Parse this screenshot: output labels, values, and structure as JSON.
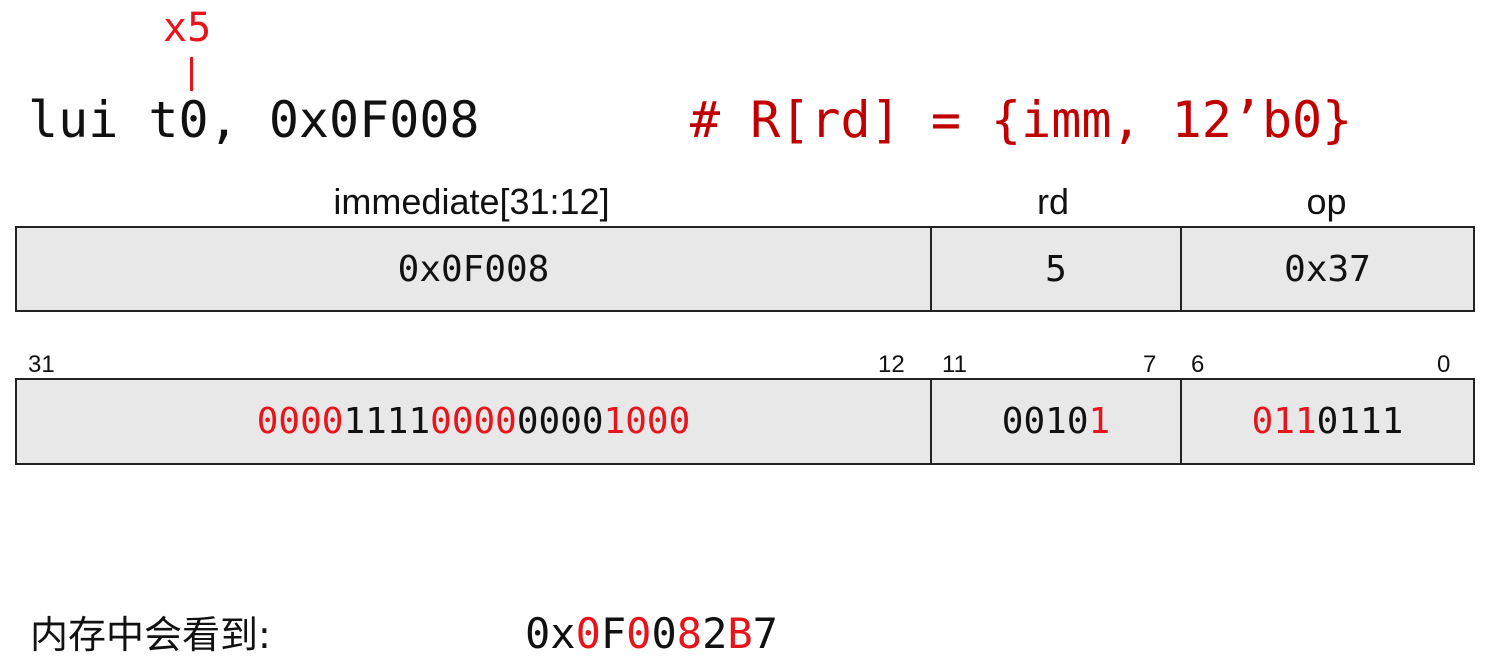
{
  "register": {
    "name": "x5"
  },
  "instruction": {
    "text": "lui t0, 0x0F008",
    "comment": "# R[rd] = {imm, 12’b0}"
  },
  "fields": {
    "headers": {
      "immediate": "immediate[31:12]",
      "rd": "rd",
      "op": "op"
    },
    "values": {
      "immediate": "0x0F008",
      "rd": "5",
      "op": "0x37"
    }
  },
  "bit_numbers": {
    "imm_hi": "31",
    "imm_lo": "12",
    "rd_hi": "11",
    "rd_lo": "7",
    "op_hi": "6",
    "op_lo": "0"
  },
  "binary": {
    "immediate_groups": [
      {
        "bits": "0000",
        "highlight": true
      },
      {
        "bits": "1111",
        "highlight": false
      },
      {
        "bits": "0000",
        "highlight": true
      },
      {
        "bits": "0000",
        "highlight": false
      },
      {
        "bits": "1000",
        "highlight": true
      }
    ],
    "rd": [
      {
        "bits": "0010",
        "highlight": false
      },
      {
        "bits": "1",
        "highlight": true
      }
    ],
    "op": [
      {
        "bits": "011",
        "highlight": true
      },
      {
        "bits": "0111",
        "highlight": false
      }
    ]
  },
  "memory": {
    "label": "内存中会看到:",
    "value_segments": [
      {
        "text": "0x",
        "highlight": false
      },
      {
        "text": "0",
        "highlight": true
      },
      {
        "text": "F",
        "highlight": false
      },
      {
        "text": "0",
        "highlight": true
      },
      {
        "text": "0",
        "highlight": false
      },
      {
        "text": "8",
        "highlight": true
      },
      {
        "text": "2",
        "highlight": false
      },
      {
        "text": "B",
        "highlight": true
      },
      {
        "text": "7",
        "highlight": false
      }
    ]
  },
  "colors": {
    "highlight": "#e8141c",
    "comment": "#c00000",
    "cell_fill": "#e8e8e8"
  }
}
